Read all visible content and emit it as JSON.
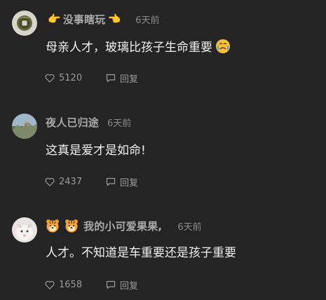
{
  "comments": [
    {
      "username": "没事瞎玩",
      "username_deco": [
        "👉",
        "👈"
      ],
      "time": "6天前",
      "text": "母亲人才，玻璃比孩子生命重要",
      "likes": "5120",
      "reply_label": "回复"
    },
    {
      "username": "夜人已归途",
      "time": "6天前",
      "text": "这真是爱才是如命!",
      "likes": "2437",
      "reply_label": "回复"
    },
    {
      "username": "我的小可爱果果,",
      "username_prefix_icons": [
        "tiger-face",
        "tiger-face"
      ],
      "time": "6天前",
      "text": "人才。不知道是车重要还是孩子重要",
      "likes": "1658",
      "reply_label": "回复"
    }
  ],
  "icons": {
    "like": "heart-outline-icon",
    "reply": "speech-bubble-icon",
    "sad_face": "crying-face-emoji"
  },
  "colors": {
    "background": "#242424",
    "text": "#f0f0f0",
    "username": "#a9a9a9",
    "meta": "#8b8b8b"
  }
}
